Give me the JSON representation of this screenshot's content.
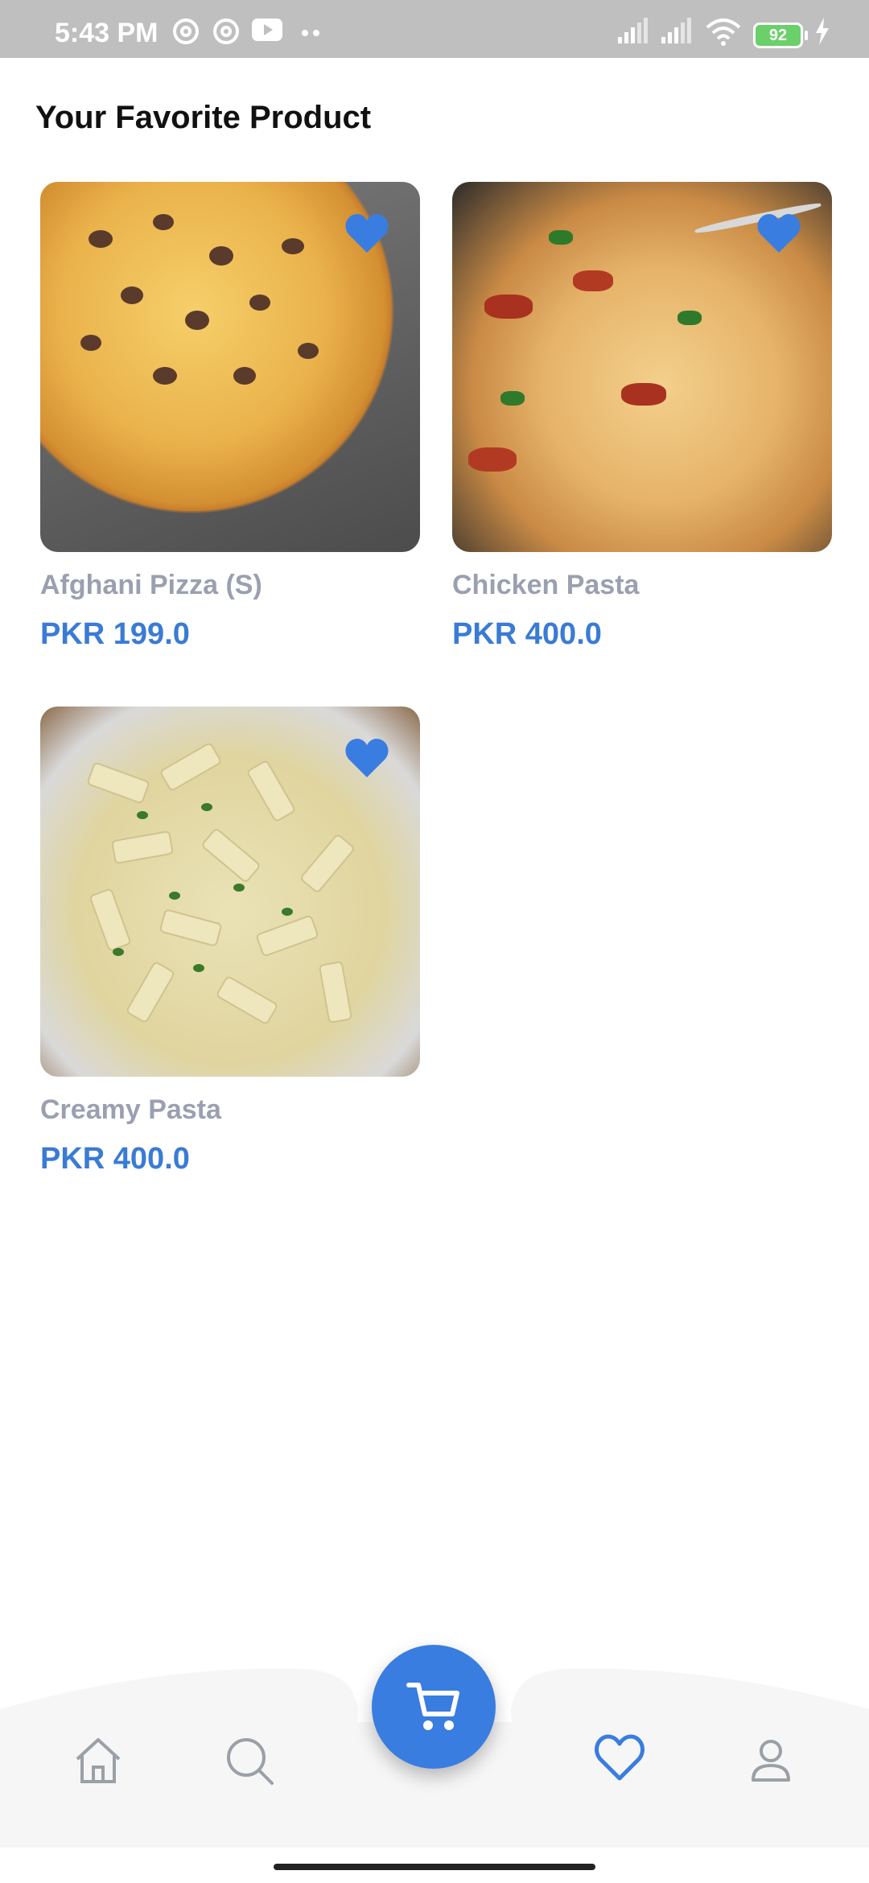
{
  "status_bar": {
    "time": "5:43 PM",
    "battery": "92"
  },
  "page": {
    "title": "Your Favorite Product"
  },
  "products": [
    {
      "name": "Afghani Pizza (S)",
      "price": "PKR 199.0",
      "image": "pizza",
      "favorite": true
    },
    {
      "name": "Chicken Pasta",
      "price": "PKR 400.0",
      "image": "chicken-pasta",
      "favorite": true
    },
    {
      "name": "Creamy Pasta",
      "price": "PKR 400.0",
      "image": "creamy-pasta",
      "favorite": true
    }
  ],
  "bottom_nav": {
    "items": [
      "home-icon",
      "search-icon",
      "cart-icon",
      "heart-icon",
      "profile-icon"
    ],
    "active": "heart-icon"
  },
  "colors": {
    "accent": "#3a7de0",
    "price": "#3a7bd5",
    "name": "#9aa0b0"
  }
}
